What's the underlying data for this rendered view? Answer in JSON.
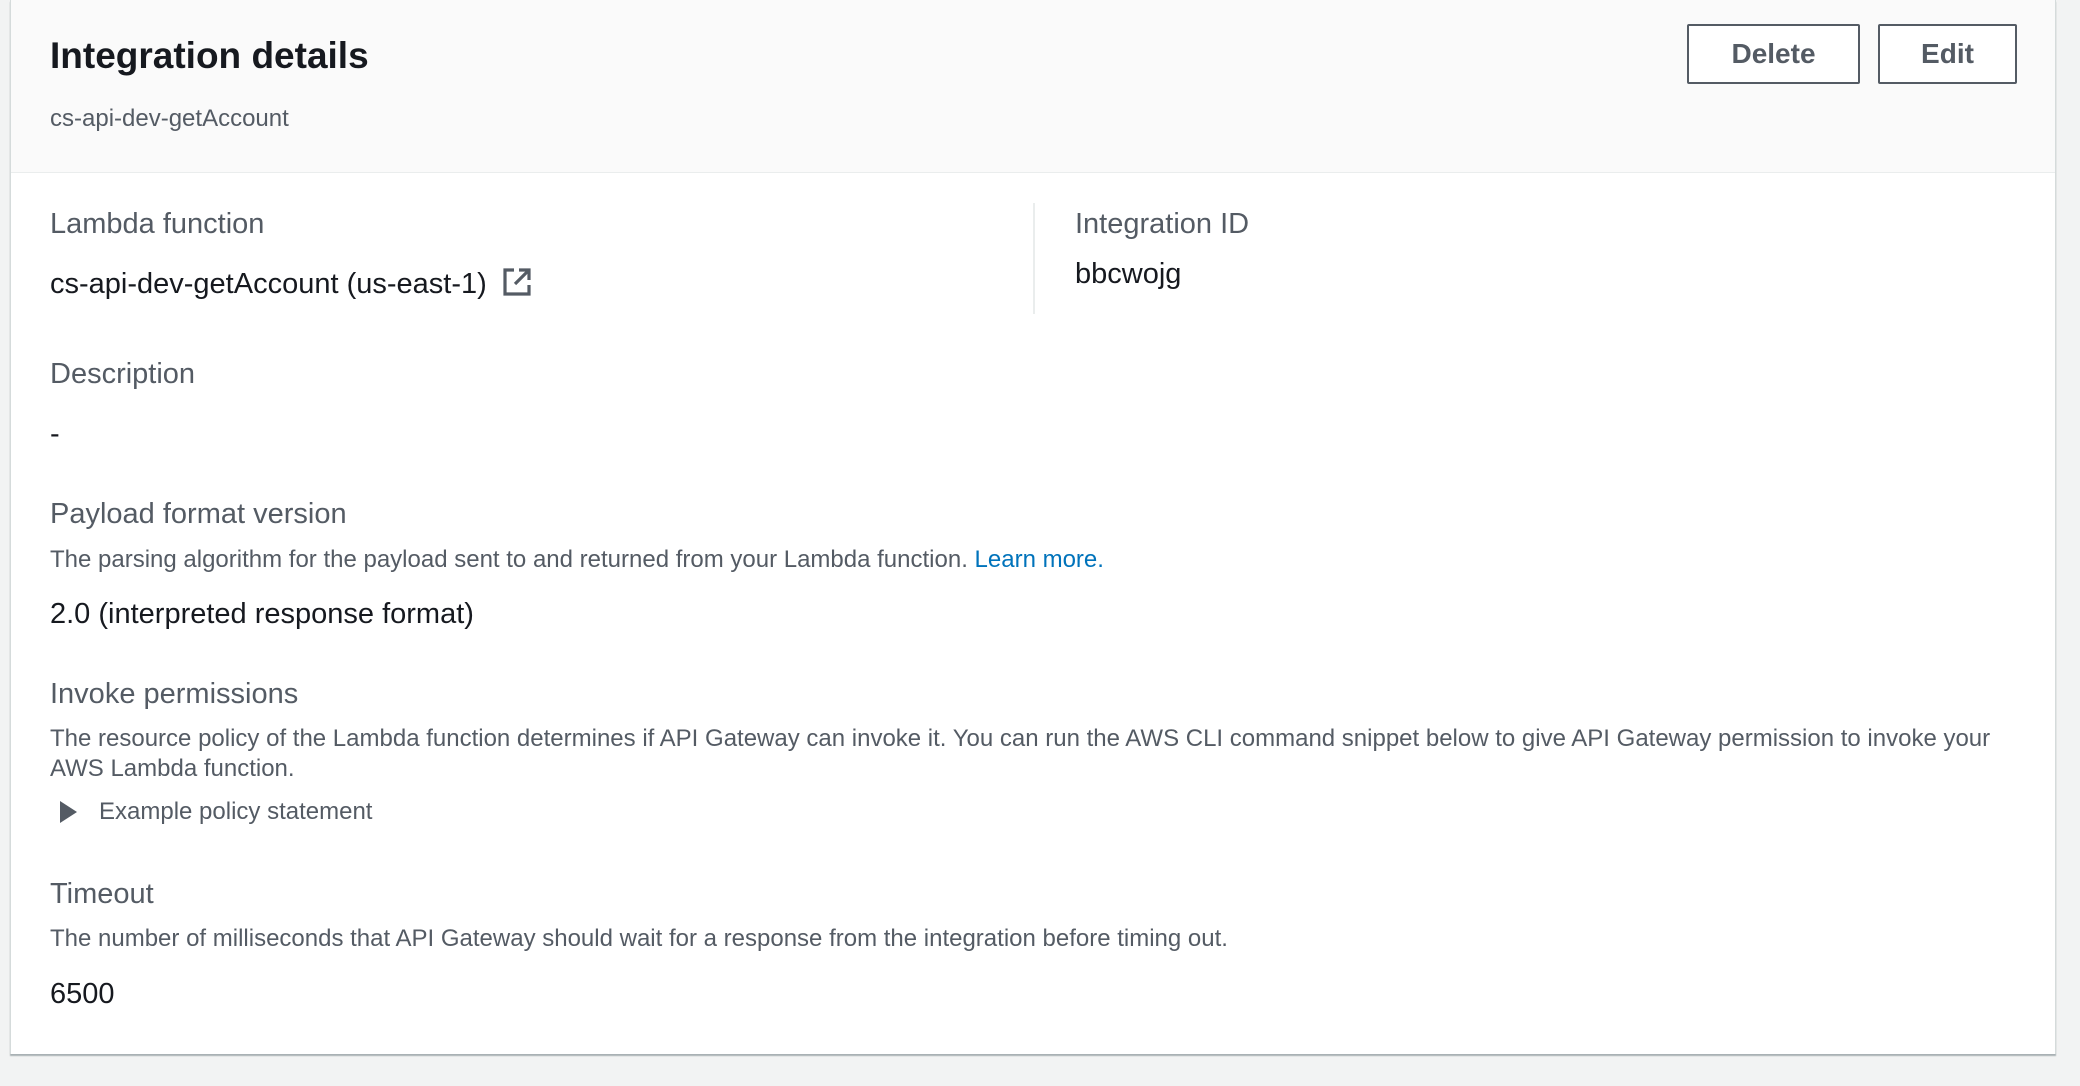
{
  "header": {
    "title": "Integration details",
    "subtitle": "cs-api-dev-getAccount",
    "delete_label": "Delete",
    "edit_label": "Edit"
  },
  "lambda_function": {
    "label": "Lambda function",
    "value": "cs-api-dev-getAccount (us-east-1)",
    "icon": "external-link-icon"
  },
  "integration_id": {
    "label": "Integration ID",
    "value": "bbcwojg"
  },
  "description": {
    "label": "Description",
    "value": "-"
  },
  "payload_format": {
    "label": "Payload format version",
    "description": "The parsing algorithm for the payload sent to and returned from your Lambda function.",
    "link_text": "Learn more.",
    "value": "2.0 (interpreted response format)"
  },
  "invoke_permissions": {
    "label": "Invoke permissions",
    "description": "The resource policy of the Lambda function determines if API Gateway can invoke it. You can run the AWS CLI command snippet below to give API Gateway permission to invoke your AWS Lambda function.",
    "expander_label": "Example policy statement",
    "expander_icon": "caret-right-icon"
  },
  "timeout": {
    "label": "Timeout",
    "description": "The number of milliseconds that API Gateway should wait for a response from the integration before timing out.",
    "value": "6500"
  },
  "colors": {
    "link": "#0073bb",
    "label": "#545b64",
    "text": "#16191f",
    "header_bg": "#fafafa",
    "page_bg": "#f2f3f3"
  }
}
